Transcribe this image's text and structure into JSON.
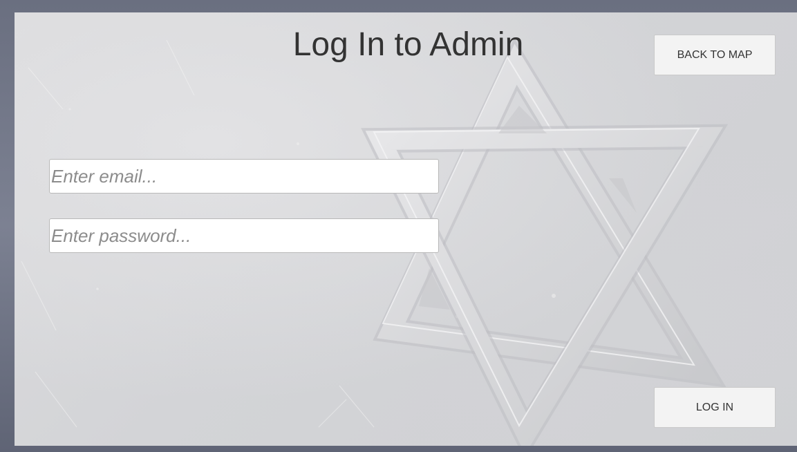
{
  "page": {
    "title": "Log In to Admin"
  },
  "toolbar": {
    "back_label": "BACK TO MAP"
  },
  "form": {
    "email_placeholder": "Enter email...",
    "email_value": "",
    "password_placeholder": "Enter password...",
    "password_value": "",
    "login_label": "LOG IN"
  },
  "background": {
    "image": "star-of-david-relief-icon"
  }
}
